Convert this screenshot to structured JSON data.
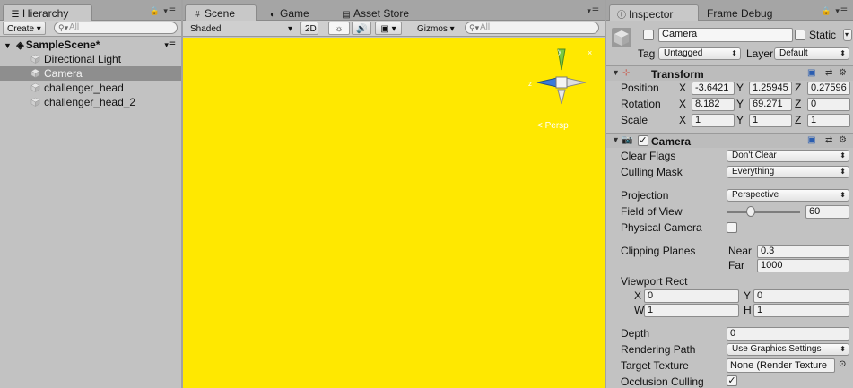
{
  "hierarchy": {
    "tab_label": "Hierarchy",
    "create_label": "Create",
    "search_placeholder": "All",
    "scene_name": "SampleScene*",
    "items": [
      {
        "label": "Directional Light"
      },
      {
        "label": "Camera"
      },
      {
        "label": "challenger_head"
      },
      {
        "label": "challenger_head_2"
      }
    ],
    "selected_index": 1
  },
  "scene_tabs": {
    "scene_label": "Scene",
    "game_label": "Game",
    "asset_store_label": "Asset Store"
  },
  "scene_toolbar": {
    "shading_mode": "Shaded",
    "mode_2d": "2D",
    "gizmos_label": "Gizmos",
    "search_placeholder": "All"
  },
  "viewport": {
    "background_color": "#ffe800",
    "gizmo_persp_label": "Persp",
    "axis_y": "y",
    "axis_z": "z"
  },
  "inspector": {
    "tab_label": "Inspector",
    "frame_debug_label": "Frame Debug",
    "object_name": "Camera",
    "static_label": "Static",
    "tag_label": "Tag",
    "tag_value": "Untagged",
    "layer_label": "Layer",
    "layer_value": "Default",
    "transform": {
      "title": "Transform",
      "position_label": "Position",
      "rotation_label": "Rotation",
      "scale_label": "Scale",
      "position": {
        "x": "-3.6421",
        "y": "1.25945",
        "z": "0.27596"
      },
      "rotation": {
        "x": "8.182",
        "y": "69.271",
        "z": "0"
      },
      "scale": {
        "x": "1",
        "y": "1",
        "z": "1"
      },
      "x_label": "X",
      "y_label": "Y",
      "z_label": "Z"
    },
    "camera": {
      "title": "Camera",
      "clear_flags_label": "Clear Flags",
      "clear_flags_value": "Don't Clear",
      "culling_mask_label": "Culling Mask",
      "culling_mask_value": "Everything",
      "projection_label": "Projection",
      "projection_value": "Perspective",
      "fov_label": "Field of View",
      "fov_value": "60",
      "fov_fraction": 0.33,
      "physical_camera_label": "Physical Camera",
      "clipping_planes_label": "Clipping Planes",
      "near_label": "Near",
      "near_value": "0.3",
      "far_label": "Far",
      "far_value": "1000",
      "viewport_rect_label": "Viewport Rect",
      "vr_x_label": "X",
      "vr_x": "0",
      "vr_y_label": "Y",
      "vr_y": "0",
      "vr_w_label": "W",
      "vr_w": "1",
      "vr_h_label": "H",
      "vr_h": "1",
      "depth_label": "Depth",
      "depth_value": "0",
      "rendering_path_label": "Rendering Path",
      "rendering_path_value": "Use Graphics Settings",
      "target_texture_label": "Target Texture",
      "target_texture_value": "None (Render Texture",
      "occlusion_culling_label": "Occlusion Culling"
    }
  }
}
